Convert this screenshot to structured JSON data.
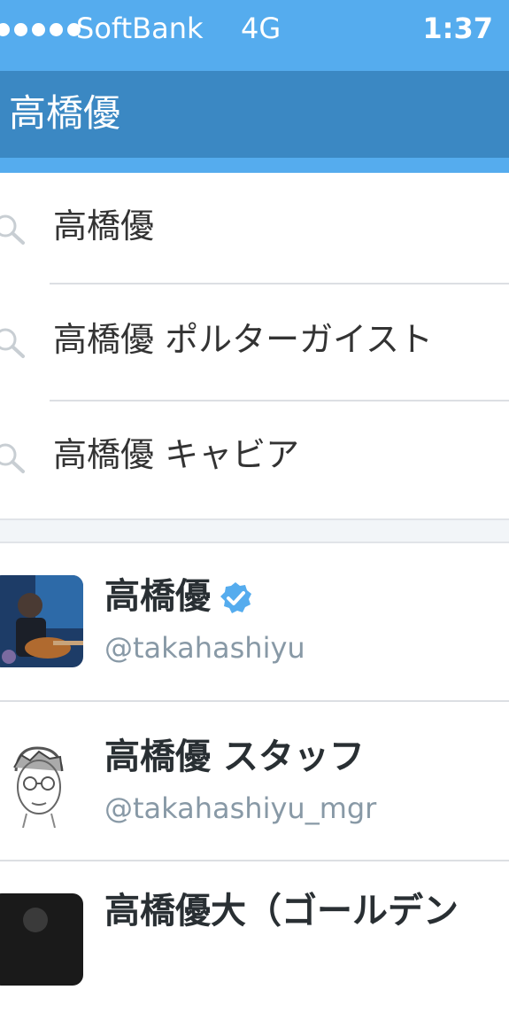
{
  "status_bar": {
    "carrier": "SoftBank",
    "network": "4G",
    "time": "1:37",
    "signal_dots": 5
  },
  "header": {
    "query": "高橋優"
  },
  "suggestions": [
    {
      "text": "高橋優",
      "icon": "search-icon"
    },
    {
      "text": "高橋優 ポルターガイスト",
      "icon": "search-icon"
    },
    {
      "text": "高橋優 キャビア",
      "icon": "search-icon"
    }
  ],
  "users": [
    {
      "name": "高橋優",
      "handle": "@takahashiyu",
      "verified": true,
      "avatar": "photo-avatar"
    },
    {
      "name": "高橋優 スタッフ",
      "handle": "@takahashiyu_mgr",
      "verified": false,
      "avatar": "sketch-avatar"
    },
    {
      "name": "高橋優大（ゴールデン",
      "handle": "",
      "verified": false,
      "avatar": "dark-avatar"
    }
  ],
  "colors": {
    "status_bar": "#55acee",
    "header": "#3b88c3",
    "verified": "#55acee",
    "handle": "#8899a6"
  }
}
